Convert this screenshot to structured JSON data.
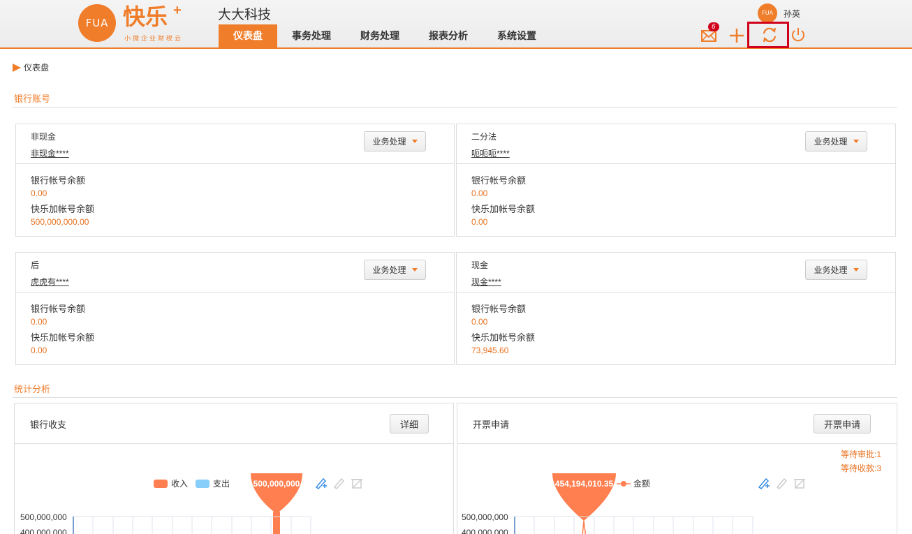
{
  "header": {
    "logo_mark": "FUA",
    "logo_text": "快乐",
    "logo_plus": "+",
    "logo_sub": "小微企业财税云",
    "company": "大大科技",
    "nav": [
      {
        "label": "仪表盘"
      },
      {
        "label": "事务处理"
      },
      {
        "label": "财务处理"
      },
      {
        "label": "报表分析"
      },
      {
        "label": "系统设置"
      }
    ],
    "user_avatar": "FUA",
    "user_name": "孙英",
    "message_count": "6",
    "colors": {
      "accent": "#f07d2a",
      "highlight": "#d0021b"
    }
  },
  "breadcrumb": "仪表盘",
  "bank_section_title": "银行账号",
  "stats_section_title": "统计分析",
  "biz_button_label": "业务处理",
  "balance_label": "银行帐号余额",
  "kuaile_balance_label": "快乐加帐号余额",
  "accounts": [
    {
      "name": "非现金",
      "number": "非现金****",
      "balance": "0.00",
      "kuaile_balance": "500,000,000.00"
    },
    {
      "name": "二分法",
      "number": "呃呃呃****",
      "balance": "0.00",
      "kuaile_balance": "0.00"
    },
    {
      "name": "后",
      "number": "虎虎有****",
      "balance": "0.00",
      "kuaile_balance": "0.00"
    },
    {
      "name": "现金",
      "number": "现金****",
      "balance": "0.00",
      "kuaile_balance": "73,945.60"
    }
  ],
  "bank_panel": {
    "title": "银行收支",
    "button": "详细",
    "legend_income": "收入",
    "legend_expense": "支出",
    "tooltip": "500,000,000",
    "y_ticks": [
      "500,000,000",
      "400,000,000"
    ]
  },
  "invoice_panel": {
    "title": "开票申请",
    "button": "开票申请",
    "pending_approval": "等待审批:1",
    "pending_payment": "等待收款:3",
    "tooltip": "454,194,010.35",
    "legend_amount": "金额",
    "y_ticks": [
      "500,000,000",
      "400,000,000"
    ]
  }
}
